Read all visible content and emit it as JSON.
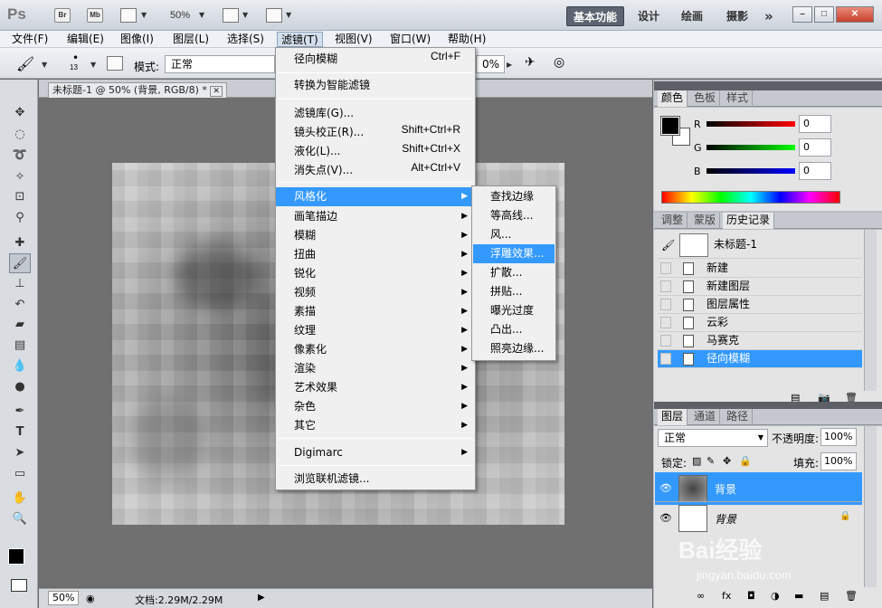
{
  "appbar": {
    "logo": "Ps",
    "br": "Br",
    "mb": "Mb",
    "zoom": "50%",
    "workspaces": [
      "基本功能",
      "设计",
      "绘画",
      "摄影"
    ],
    "more": "»"
  },
  "menubar": {
    "items": [
      "文件(F)",
      "编辑(E)",
      "图像(I)",
      "图层(L)",
      "选择(S)",
      "滤镜(T)",
      "视图(V)",
      "窗口(W)",
      "帮助(H)"
    ]
  },
  "options": {
    "brush_size": "13",
    "mode_label": "模式:",
    "mode_value": "正常",
    "opacity_partial": "0%"
  },
  "document": {
    "tab_title": "未标题-1 @ 50% (背景, RGB/8) *",
    "zoom": "50%",
    "status": "文档:2.29M/2.29M"
  },
  "filter_menu": {
    "items": [
      {
        "label": "径向模糊",
        "shortcut": "Ctrl+F"
      },
      {
        "label": "转换为智能滤镜"
      },
      {
        "label": "滤镜库(G)..."
      },
      {
        "label": "镜头校正(R)...",
        "shortcut": "Shift+Ctrl+R"
      },
      {
        "label": "液化(L)...",
        "shortcut": "Shift+Ctrl+X"
      },
      {
        "label": "消失点(V)...",
        "shortcut": "Alt+Ctrl+V"
      },
      {
        "label": "风格化",
        "highlighted": true
      },
      {
        "label": "画笔描边"
      },
      {
        "label": "模糊"
      },
      {
        "label": "扭曲"
      },
      {
        "label": "锐化"
      },
      {
        "label": "视频"
      },
      {
        "label": "素描"
      },
      {
        "label": "纹理"
      },
      {
        "label": "像素化"
      },
      {
        "label": "渲染"
      },
      {
        "label": "艺术效果"
      },
      {
        "label": "杂色"
      },
      {
        "label": "其它"
      },
      {
        "label": "Digimarc"
      },
      {
        "label": "浏览联机滤镜..."
      }
    ]
  },
  "stylize_submenu": {
    "items": [
      "查找边缘",
      "等高线...",
      "风...",
      "浮雕效果...",
      "扩散...",
      "拼贴...",
      "曝光过度",
      "凸出...",
      "照亮边缘..."
    ],
    "highlighted": "浮雕效果..."
  },
  "color_panel": {
    "tabs": [
      "颜色",
      "色板",
      "样式"
    ],
    "r_label": "R",
    "g_label": "G",
    "b_label": "B",
    "r": "0",
    "g": "0",
    "b": "0"
  },
  "history_panel": {
    "tabs": [
      "调整",
      "蒙版",
      "历史记录"
    ],
    "snapshot": "未标题-1",
    "items": [
      "新建",
      "新建图层",
      "图层属性",
      "云彩",
      "马赛克",
      "径向模糊"
    ]
  },
  "layers_panel": {
    "tabs": [
      "图层",
      "通道",
      "路径"
    ],
    "blend": "正常",
    "opacity_label": "不透明度:",
    "opacity": "100%",
    "lock_label": "锁定:",
    "fill_label": "填充:",
    "fill": "100%",
    "layers": [
      "背景",
      "背景"
    ]
  },
  "watermark": {
    "brand": "Bai经验",
    "url": "jingyan.baidu.com"
  }
}
